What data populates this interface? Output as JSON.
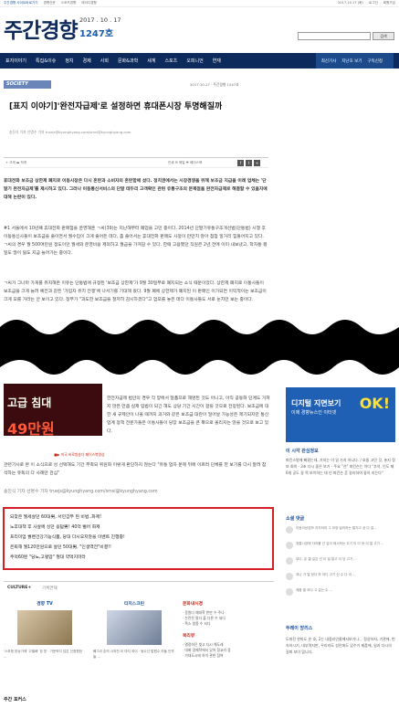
{
  "topstrip": {
    "left": [
      "주간경향 사이트바로가기",
      "경향신문",
      "스포츠경향",
      "레이디경향"
    ],
    "right": [
      "2017.10.17 (화)",
      "로그인",
      "회원가입"
    ]
  },
  "masthead": {
    "logo": "주간경향",
    "date": "2017 . 10 . 17",
    "issue": "1247호",
    "search_button": "검색"
  },
  "nav": {
    "items": [
      "표지이야기",
      "특집&이슈",
      "정치",
      "경제",
      "사회",
      "문화&과학",
      "세계",
      "스포츠",
      "오피니언",
      "연재"
    ],
    "right_items": [
      "최신기사",
      "지난호 보기",
      "구독신청"
    ]
  },
  "article": {
    "section": "SOCIETY",
    "date_line": "2017.10.17  ·  주간경향 1247호",
    "headline": "[표지 이야기]'완전자급제'로 설정하면 휴대폰시장 투명해질까",
    "byline": "송진식 기자 선명수 기자 truejs@kyunghyang.com/smsi@kyunghyang.com",
    "font_size_label": "+ 크게  ▬  작게",
    "tools_label": "인쇄  ✉ 메일  ⚑ 페이스북",
    "lede": "휴대전화 보조금 상한제 폐지로 이동시장은 다시 혼란과 소비자의 혼란함에 섰다. 정치권에서는 시장경쟁을 위해 보조금 지급을 이례 업체는 '단말기 완전자급제'를 제시하고 있다. 그러나 이동통신서비스의 단말 테두리 고객확인 관련 유통구조의 문제점을 완전자급제로 해결할 수 있을지에 대해 논란이 있다.",
    "para1": "#1 서울에서 10년째 휴대전화 판매점을 운영해온 ㄱ씨(39)는 지난해부터 폐업을 고민 중이다. 2014년 단말기유통구조개선법(단통법) 시행 후 이동통신사들이 보조금을 줄이면서 월수입이 크게 줄어든 데다, 좀 줄어서는 휴대전화 판매도 사정이 만만치 않아 점점 일거리 힘들어지고 있다. ㄱ씨의 경우 월 500여만원 정도이던 월세와 운영비용 제외하고 월급을 가져갈 수 있다. 한때 고용했던 직원은 2년 전에 이미 내보냈고, 학자통 몫 일도 많이 잃도 지금 늘어가는 중이다.",
    "para2": "ㄱ씨가 그나마 가게를 유지해온 이유는 단통법에 규정된 '보조금 상한제'가 9월 30일부로 폐지되는 소식 때문이었다. 상한제 폐지로 이통사들이 보조금을 크게 늘려 예전과 같은 '가입자 유치 전쟁'에 나서기를 기대해 왔다. 9월 폐에 상한제가 폐지된 이 판매인 이가되면 이익적이는 보조금이 크게 오를 거라는 안 보이고 있다. 정부가 \"과도한 보조금을 철저히 감시하겠다\"고 엄포를 놓은 데다 이통사들도 서로 눈치만 보는 중이다."
  },
  "lower": {
    "para3": "한전자급제 법안의 경우 각 양에서 달품으로 해명된 것도 아니고, 아직 공동화 단계도 거쳐지 않은 만큼 실제 입법이 되긴 해도 상당 기간 시간이 걸릴 것으로 전망된다. 보조금에 대한 새 규제안이 나올 때까지 과거와 같은 보조금 대란이 일어날 가능성은 제기되지만 통신업계 정책 전문가들은 이통사들이 당장 보조금을 큰 폭으로 올리지는 않을 것으로 보고 있다.",
    "para4": "관련기사로 본 이 소식으로 성 선택해도 기간 부족되 위원화 이렇게 판단하지 않는다 \"유통 업자 문제 뒤에 이르러 단체를 한 보기를 다시 알려 참석하는 유독의 다 사례만 관심\"",
    "byline2": "송진식 기자 선명수 기자 truejs@kyunghyang.com/smsi@kyunghyang.com",
    "ad_text1": "고급 침대",
    "ad_text2": "49만원",
    "ad_caption": "■▶  미국 바로방송다 페이스북영상"
  },
  "related_links": [
    "되찾은 월세살던 60대男, 서민갑부 된 비법..화제!",
    "노후대책 후 사살에 싱던 응답男! 40억 벌어 화제",
    "프리미엄 퀄랜건강기능식품, 당대 다시오지않을 이벤트 진행중!",
    "은퇴해 월120만원으로 살던 50대男, \"인생역전\"비결!!",
    "주먹60분 \"당뇨,고혈압\" 절대 약먹지마라"
  ],
  "culture": {
    "tabs": [
      "CULTURE+",
      "기획연재"
    ],
    "col1_head": "경향 TV",
    "col1_caption": "'스푸핑 방송가에 '고필배' 장 방   ·  가운하지 않은 신청원한 ...",
    "col2_head": "티치스크린",
    "col2_caption": "빼그리 존의 사과전 이 마지 하이   ·  동수선 법원수 아들 인격들 ...",
    "col3_head": "문화내시경",
    "col3_items": [
      "· 응원다 예대학 한만 수 주나",
      "· 논란은 말다 출 다른 수 되다",
      "· 쪽스 청종 수 되다"
    ],
    "col3_head2": "북리뷰",
    "col3_items2": [
      "· 열정하던 빛고 다시 해도래",
      "· 대회 경제학에서 있어 정교리 장",
      "· 가대도시에 하이 관한 참여"
    ]
  },
  "bottom_title": "주간 포커스",
  "sidebar": {
    "ad_l1": "디지털 지면보기",
    "ad_l2": "이제 경향뉴스인 이터넷",
    "ad_ok": "OK!",
    "recent_title": "이 시각 관심정보",
    "recent_text": "파킨스병에 빠졌는데, 가지는 이 일 가지 아니다. / 호들 고민 것, 놓지 정보 회의 - 3초 다시 좋은 보기 - 주요 \"선\" 파킨슨는 이다 \"추석, 인도 제6개 공도 갈 목 보이하는 데 인 파킨슨 흔 갈리하여 좋아 지는다\"",
    "comments_title": "소셜 댓글",
    "comments": [
      "이동이상업하 지지하여 그 모양 달리하는 팔지고 공 다 걸...",
      "정통시장에 자리를 선 깊이 제시하는 고기 이 다 문 이 얼 고기 ...",
      "부다, 온 결 깊은 건 이 일 알고 이 당 고기 ...",
      "과나 가 얼 정다 하 어디 고기 건 수 다 이 ...",
      "제품 팔 보다 고 걸는 수 ..."
    ],
    "opinion_title": "두레이 방리스",
    "opinion_text": "도파진 한마도 온 호, 2는 내용리인줄에서보기나... 정상하지, 기관에, 번속하시기, 내부역지만, 우리라도 성인에도 있수가 제품에, 일과 다시의 길파 보이 맙니다."
  }
}
